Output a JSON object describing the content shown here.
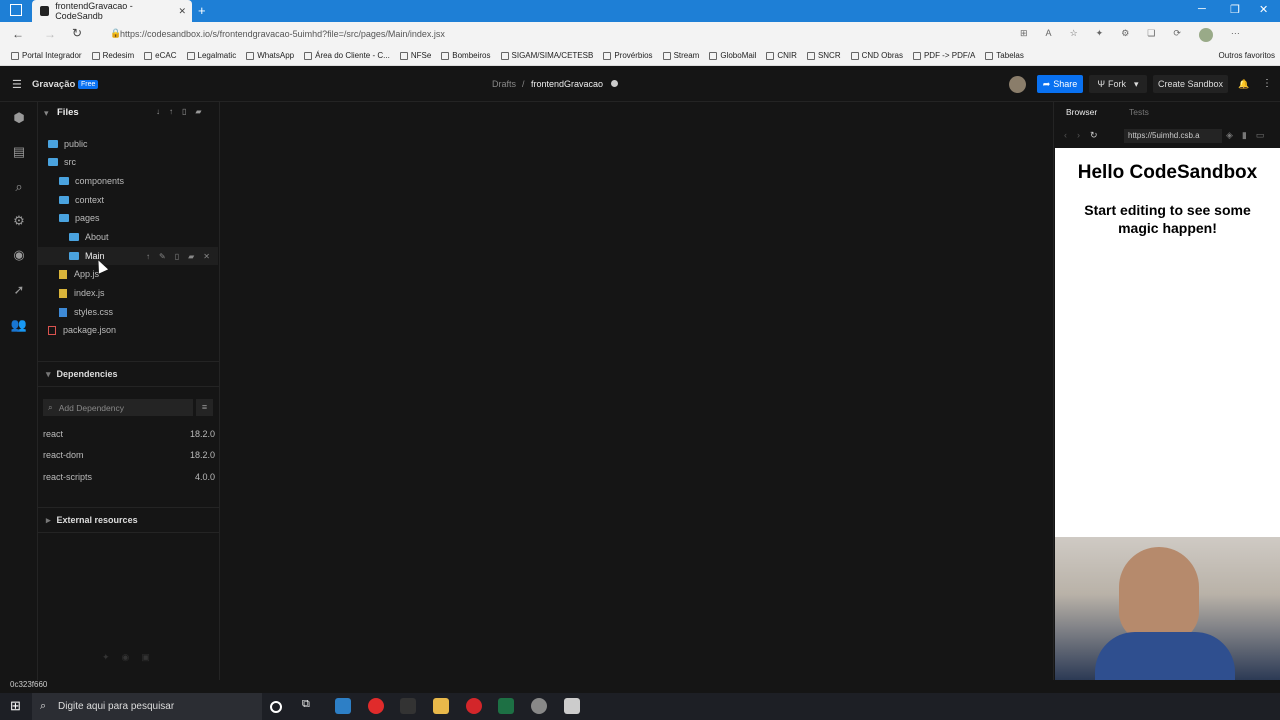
{
  "browser": {
    "tab_title": "frontendGravacao - CodeSandb",
    "url": "https://codesandbox.io/s/frontendgravacao-5uimhd?file=/src/pages/Main/index.jsx",
    "bookmarks": [
      "Portal Integrador",
      "Redesim",
      "eCAC",
      "Legalmatic",
      "WhatsApp",
      "Área do Cliente - C...",
      "NFSe",
      "Bombeiros",
      "SIGAM/SIMA/CETESB",
      "Provérbios",
      "Stream",
      "GloboMail",
      "CNIR",
      "SNCR",
      "CND Obras",
      "PDF -> PDF/A",
      "Tabelas"
    ],
    "other_favorites": "Outros favoritos"
  },
  "header": {
    "app_name": "Gravação",
    "plan_badge": "Free",
    "breadcrumb_root": "Drafts",
    "breadcrumb_sep": "/",
    "sandbox_name": "frontendGravacao",
    "share_label": "Share",
    "fork_label": "Fork",
    "create_label": "Create Sandbox"
  },
  "files": {
    "title": "Files",
    "tree": {
      "public": "public",
      "src": "src",
      "components": "components",
      "context": "context",
      "pages": "pages",
      "about": "About",
      "main": "Main",
      "app": "App.js",
      "index": "index.js",
      "styles": "styles.css",
      "package": "package.json"
    }
  },
  "dependencies": {
    "title": "Dependencies",
    "placeholder": "Add Dependency",
    "items": [
      {
        "name": "react",
        "version": "18.2.0"
      },
      {
        "name": "react-dom",
        "version": "18.2.0"
      },
      {
        "name": "react-scripts",
        "version": "4.0.0"
      }
    ]
  },
  "external": {
    "title": "External resources"
  },
  "preview": {
    "tab_browser": "Browser",
    "tab_tests": "Tests",
    "address": "https://5uimhd.csb.a",
    "heading": "Hello CodeSandbox",
    "subheading": "Start editing to see some magic happen!"
  },
  "status": {
    "hash": "0c323f660"
  },
  "taskbar": {
    "search_placeholder": "Digite aqui para pesquisar"
  },
  "colors": {
    "accent": "#0971f1",
    "folder": "#4aa3df",
    "chrome": "#1e7fd6"
  }
}
